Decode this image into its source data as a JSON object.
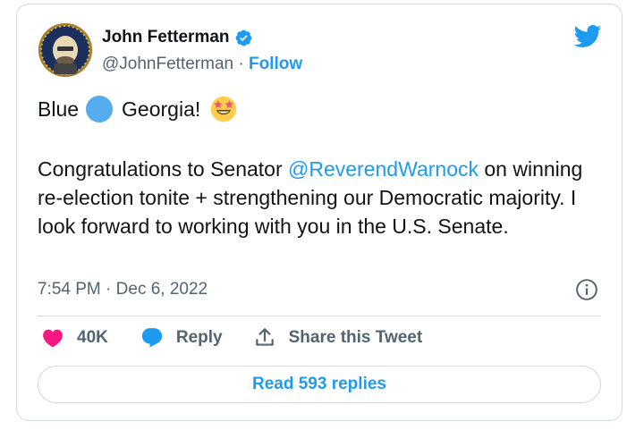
{
  "user": {
    "name": "John Fetterman",
    "handle": "@JohnFetterman",
    "separator": "·",
    "follow_label": "Follow"
  },
  "tweet": {
    "line1_before": "Blue",
    "line1_after": "Georgia!",
    "emoji_1": "blue-circle",
    "emoji_2": "star-struck",
    "para_before": "Congratulations to Senator ",
    "mention": "@ReverendWarnock",
    "para_after": " on winning re-election tonite + strengthening our Democratic majority. I look forward to working with you in the U.S. Senate."
  },
  "meta": {
    "time": "7:54 PM",
    "separator": "·",
    "date": "Dec 6, 2022"
  },
  "actions": {
    "like_count": "40K",
    "reply_label": "Reply",
    "share_label": "Share this Tweet"
  },
  "read_replies_label": "Read 593 replies",
  "icons": {
    "brand": "twitter-bird-icon",
    "verified": "verified-badge-icon",
    "info": "info-icon",
    "like": "heart-icon",
    "reply": "reply-bubble-icon",
    "share": "share-icon"
  },
  "colors": {
    "accent": "#1d9bf0",
    "like": "#f91880",
    "muted": "#536471",
    "border": "#cfd9de",
    "emoji_blue": "#55acee"
  }
}
